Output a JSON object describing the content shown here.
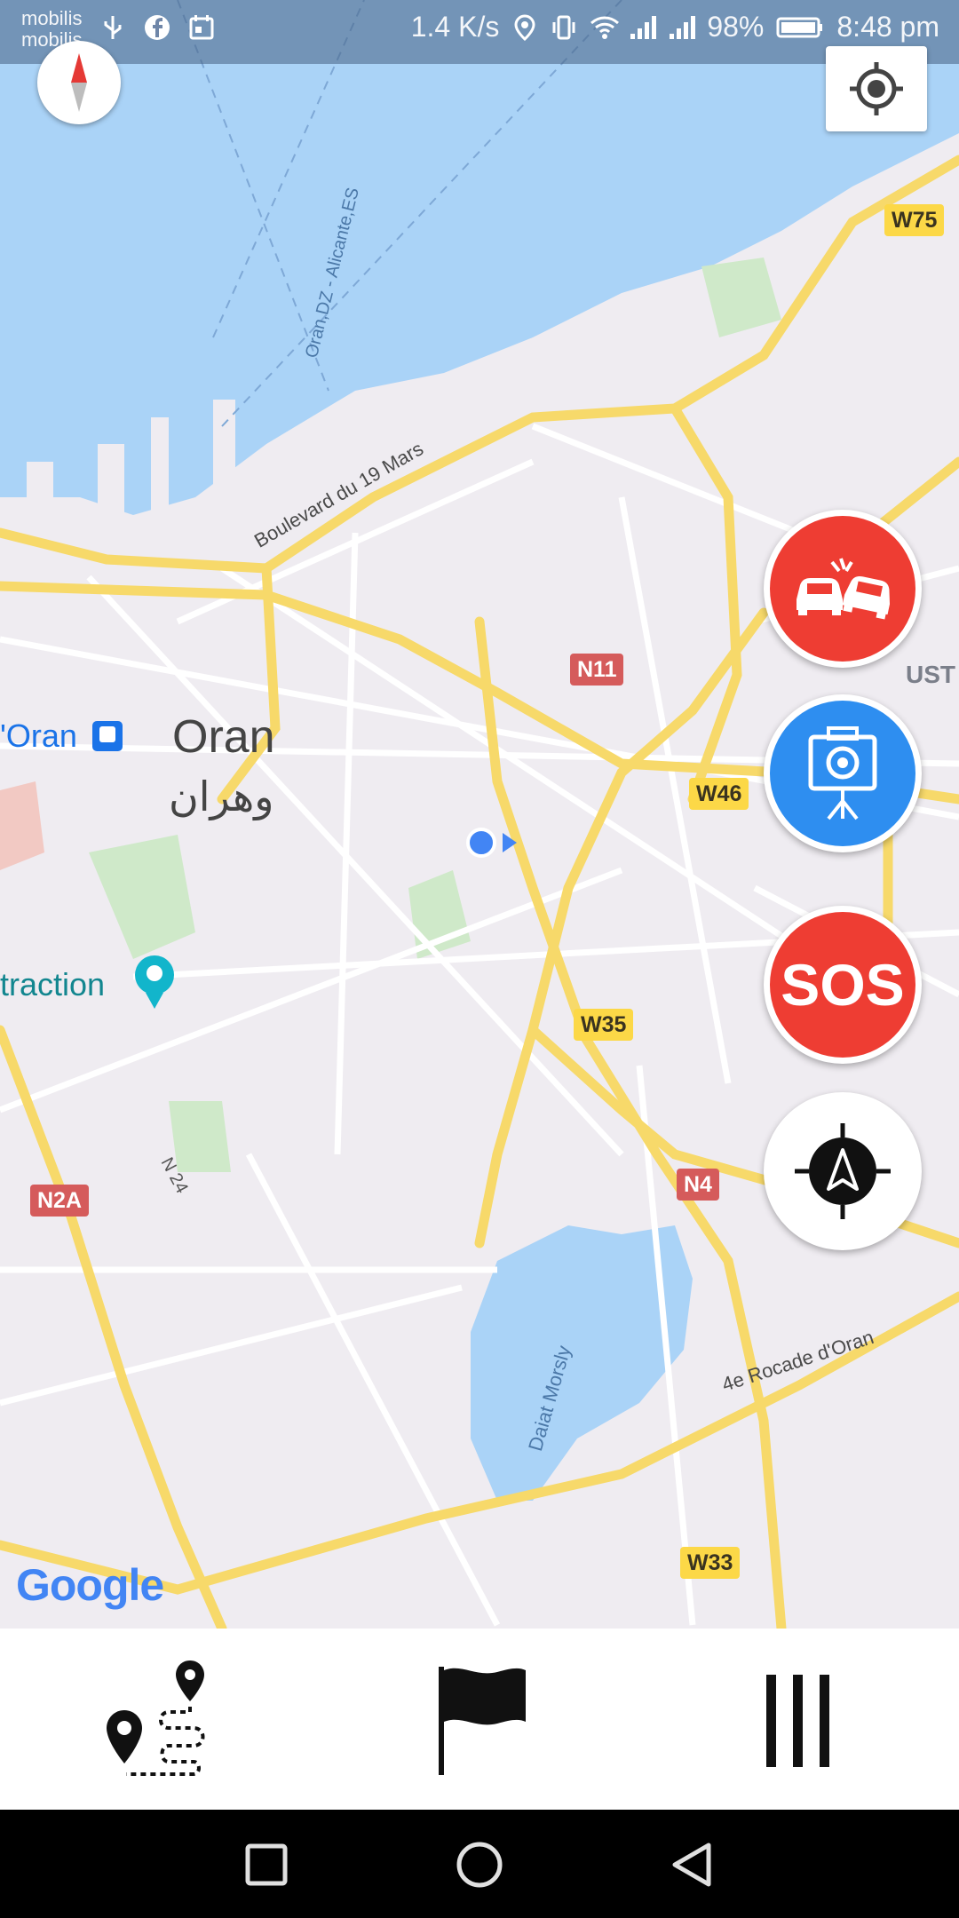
{
  "status_bar": {
    "carrier_1": "mobilis",
    "carrier_2": "mobilis",
    "speed": "1.4 K/s",
    "battery": "98%",
    "time": "8:48 pm"
  },
  "map": {
    "city_name": "Oran",
    "city_name_arabic": "وهران",
    "station_label": "'Oran",
    "attraction_label": "traction",
    "street_boulevard": "Boulevard du 19 Mars",
    "street_rocade": "4e Rocade d'Oran",
    "sea_route": "Oran,DZ - Alicante,ES",
    "lake_label": "Daiat Morsly",
    "road_n24": "N 24",
    "area_ust": "UST",
    "shields": {
      "w75": "W75",
      "n11": "N11",
      "w46": "W46",
      "w35": "W35",
      "n4": "N4",
      "n2a": "N2A",
      "w33": "W33"
    },
    "attribution": "Google"
  },
  "fab": {
    "sos_label": "SOS",
    "accident_icon": "car-crash-icon",
    "camera_icon": "speed-camera-icon",
    "navigate_icon": "navigation-compass-icon",
    "colors": {
      "red": "#ee3d33",
      "blue": "#2e8ef0"
    }
  },
  "bottom_nav": {
    "route_icon": "route-pins-icon",
    "flag_icon": "flag-icon",
    "menu_icon": "menu-bars-icon"
  },
  "system_nav": {
    "recents_icon": "square-icon",
    "home_icon": "circle-icon",
    "back_icon": "triangle-back-icon"
  }
}
